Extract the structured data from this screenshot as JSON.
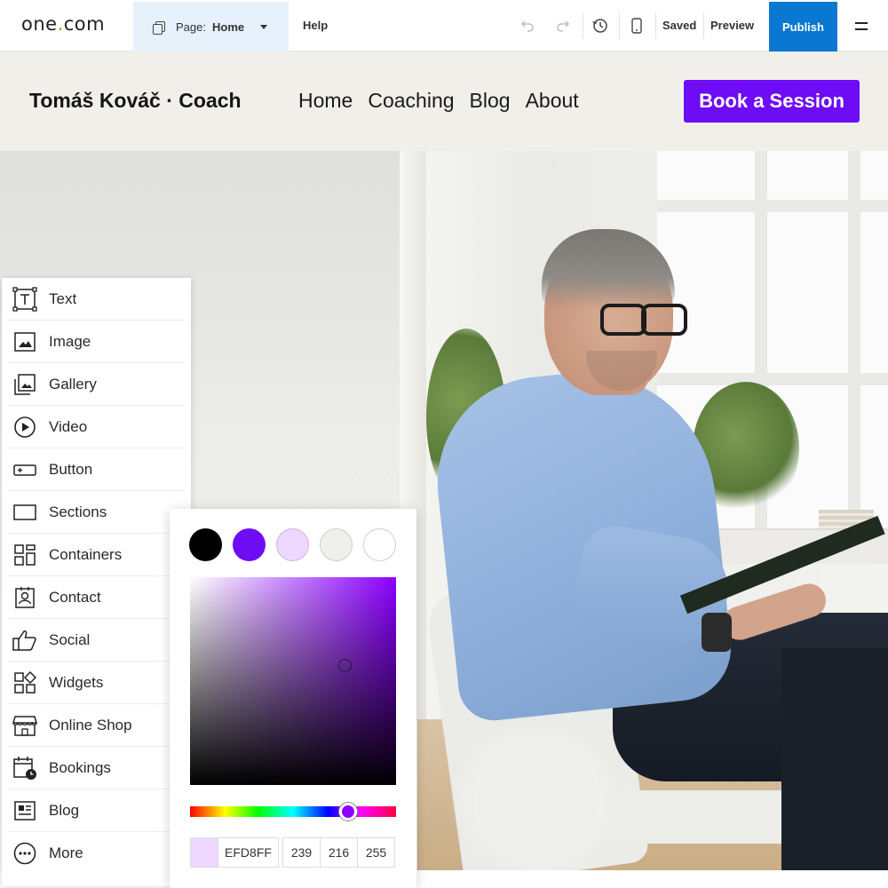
{
  "topbar": {
    "logo_text": "one",
    "logo_dot": ".",
    "logo_suffix": "com",
    "page_prefix": "Page:",
    "page_name": "Home",
    "help_label": "Help",
    "saved_label": "Saved",
    "preview_label": "Preview",
    "publish_label": "Publish",
    "accent": "#0a78d1"
  },
  "site": {
    "brand": "Tomáš Kováč · Coach",
    "nav": [
      "Home",
      "Coaching",
      "Blog",
      "About"
    ],
    "cta_label": "Book a Session",
    "cta_color": "#6d0cf5",
    "header_bg": "#f0efea"
  },
  "elements_panel": {
    "items": [
      {
        "label": "Text",
        "icon": "text-icon"
      },
      {
        "label": "Image",
        "icon": "image-icon"
      },
      {
        "label": "Gallery",
        "icon": "gallery-icon"
      },
      {
        "label": "Video",
        "icon": "video-icon"
      },
      {
        "label": "Button",
        "icon": "button-icon"
      },
      {
        "label": "Sections",
        "icon": "sections-icon"
      },
      {
        "label": "Containers",
        "icon": "containers-icon"
      },
      {
        "label": "Contact",
        "icon": "contact-icon"
      },
      {
        "label": "Social",
        "icon": "social-icon"
      },
      {
        "label": "Widgets",
        "icon": "widgets-icon"
      },
      {
        "label": "Online Shop",
        "icon": "shop-icon"
      },
      {
        "label": "Bookings",
        "icon": "bookings-icon"
      },
      {
        "label": "Blog",
        "icon": "blog-icon"
      },
      {
        "label": "More",
        "icon": "more-icon"
      }
    ]
  },
  "color_picker": {
    "swatches": [
      "#000000",
      "#6d0cf5",
      "#efd8ff",
      "#f0efea",
      "#ffffff"
    ],
    "selected_swatch": "#efd8ff",
    "hue_color": "#8b00ff",
    "hex": "EFD8FF",
    "r": "239",
    "g": "216",
    "b": "255"
  }
}
